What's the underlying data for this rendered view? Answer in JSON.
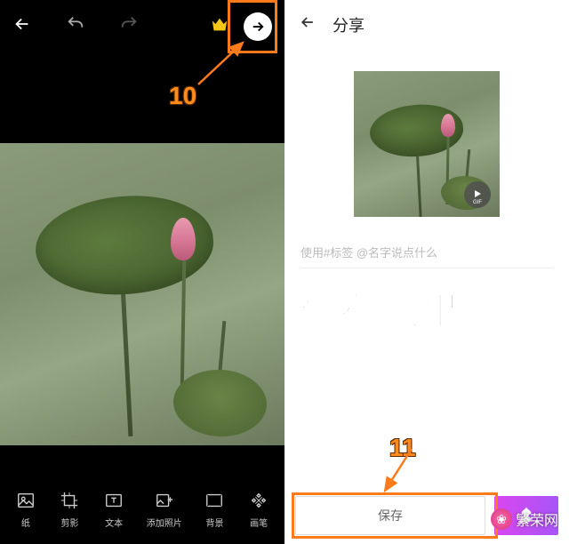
{
  "left": {
    "toolbar": {
      "items": [
        {
          "name": "wallpaper-tool",
          "label": "纸",
          "icon": "image"
        },
        {
          "name": "crop-tool",
          "label": "剪影",
          "icon": "crop"
        },
        {
          "name": "text-tool",
          "label": "文本",
          "icon": "text"
        },
        {
          "name": "add-photo-tool",
          "label": "添加照片",
          "icon": "add-photo"
        },
        {
          "name": "background-tool",
          "label": "背景",
          "icon": "background"
        },
        {
          "name": "brush-tool",
          "label": "画笔",
          "icon": "brush"
        }
      ]
    }
  },
  "right": {
    "title": "分享",
    "caption_placeholder": "使用#标签 @名字说点什么",
    "gif_label": "GIF",
    "save_label": "保存"
  },
  "overlay": {
    "main_text": "保存效果图",
    "label_10": "10",
    "label_11": "11"
  },
  "watermark": {
    "text": "繁荣网"
  }
}
